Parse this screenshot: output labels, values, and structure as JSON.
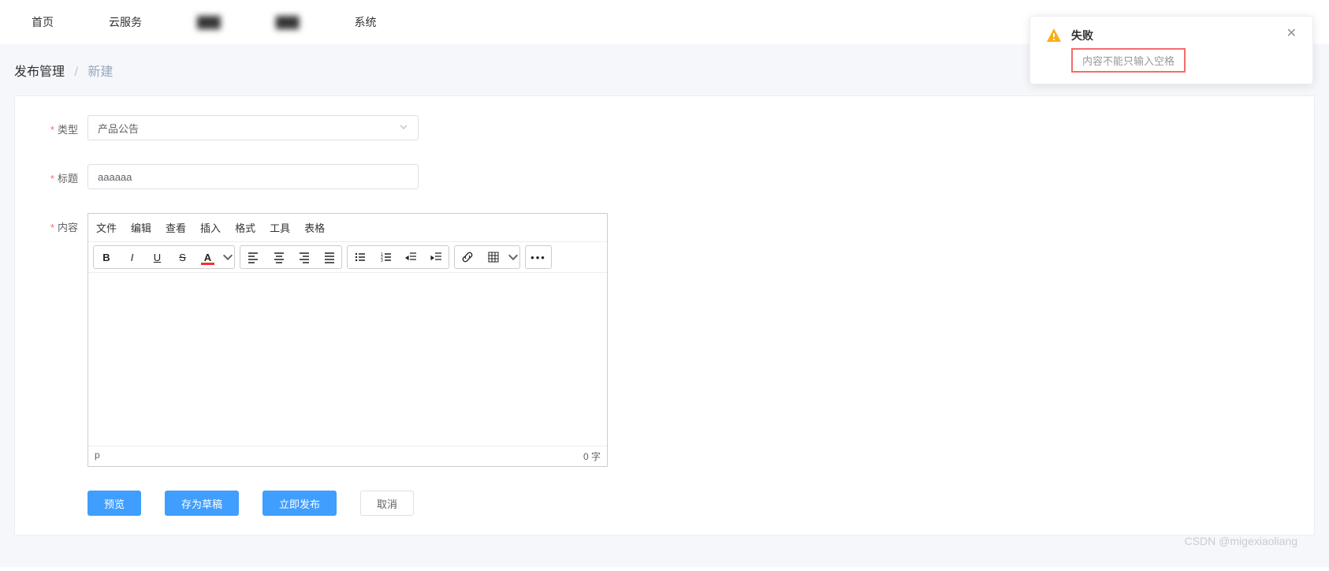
{
  "nav": {
    "items": [
      "首页",
      "云服务",
      "███",
      "███",
      "系统"
    ]
  },
  "breadcrumb": {
    "main": "发布管理",
    "separator": "/",
    "sub": "新建"
  },
  "form": {
    "type": {
      "label": "类型",
      "value": "产品公告"
    },
    "title": {
      "label": "标题",
      "value": "aaaaaa"
    },
    "content": {
      "label": "内容"
    }
  },
  "editor": {
    "menus": [
      "文件",
      "编辑",
      "查看",
      "插入",
      "格式",
      "工具",
      "表格"
    ],
    "status_path": "p",
    "word_count": "0 字"
  },
  "actions": {
    "preview": "预览",
    "draft": "存为草稿",
    "publish": "立即发布",
    "cancel": "取消"
  },
  "toast": {
    "title": "失败",
    "message": "内容不能只输入空格"
  },
  "watermark": "CSDN @migexiaoliang"
}
